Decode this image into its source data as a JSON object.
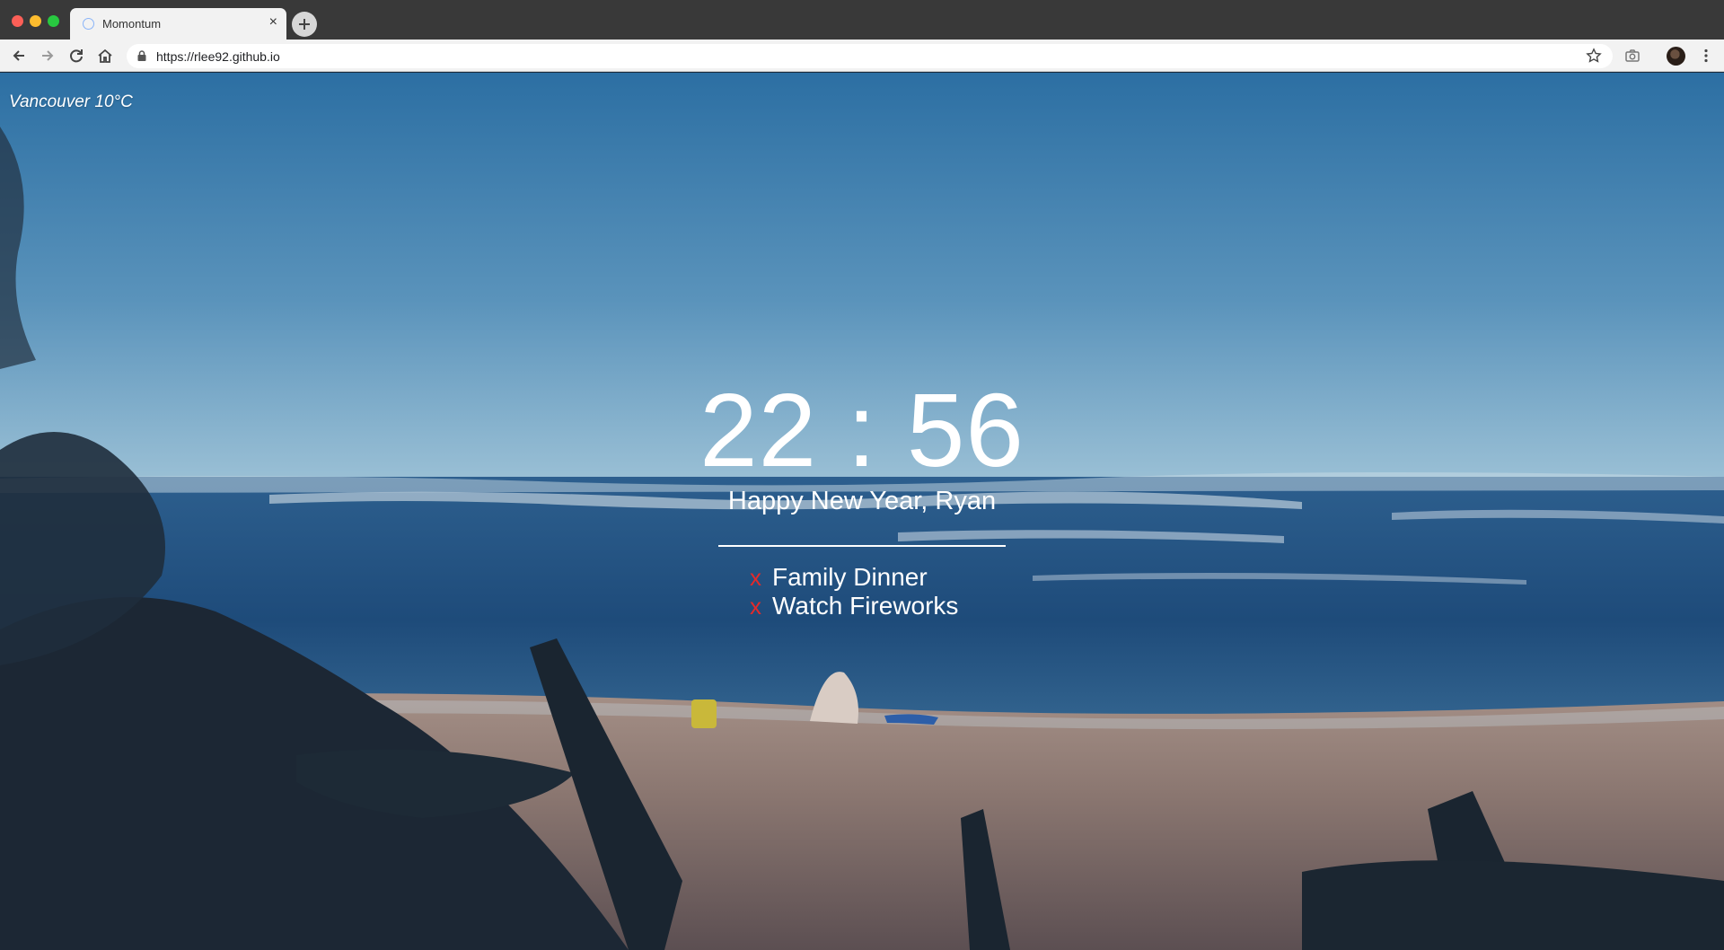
{
  "browser": {
    "tab_title": "Momontum",
    "tab_close": "×",
    "url": "https://rlee92.github.io",
    "icons": [
      "back-icon",
      "forward-icon",
      "reload-icon",
      "home-icon",
      "lock-icon",
      "star-icon",
      "camera-icon",
      "avatar",
      "menu-icon"
    ]
  },
  "page": {
    "weather": "Vancouver 10°C",
    "clock": "22 : 56",
    "greeting": "Happy New Year, Ryan",
    "todos": [
      {
        "remove": "x",
        "label": "Family Dinner"
      },
      {
        "remove": "x",
        "label": "Watch Fireworks"
      }
    ]
  },
  "colors": {
    "chrome_dark": "#393939",
    "chrome_light": "#f2f2f2",
    "todo_remove": "#e42a2a",
    "text": "#ffffff"
  }
}
